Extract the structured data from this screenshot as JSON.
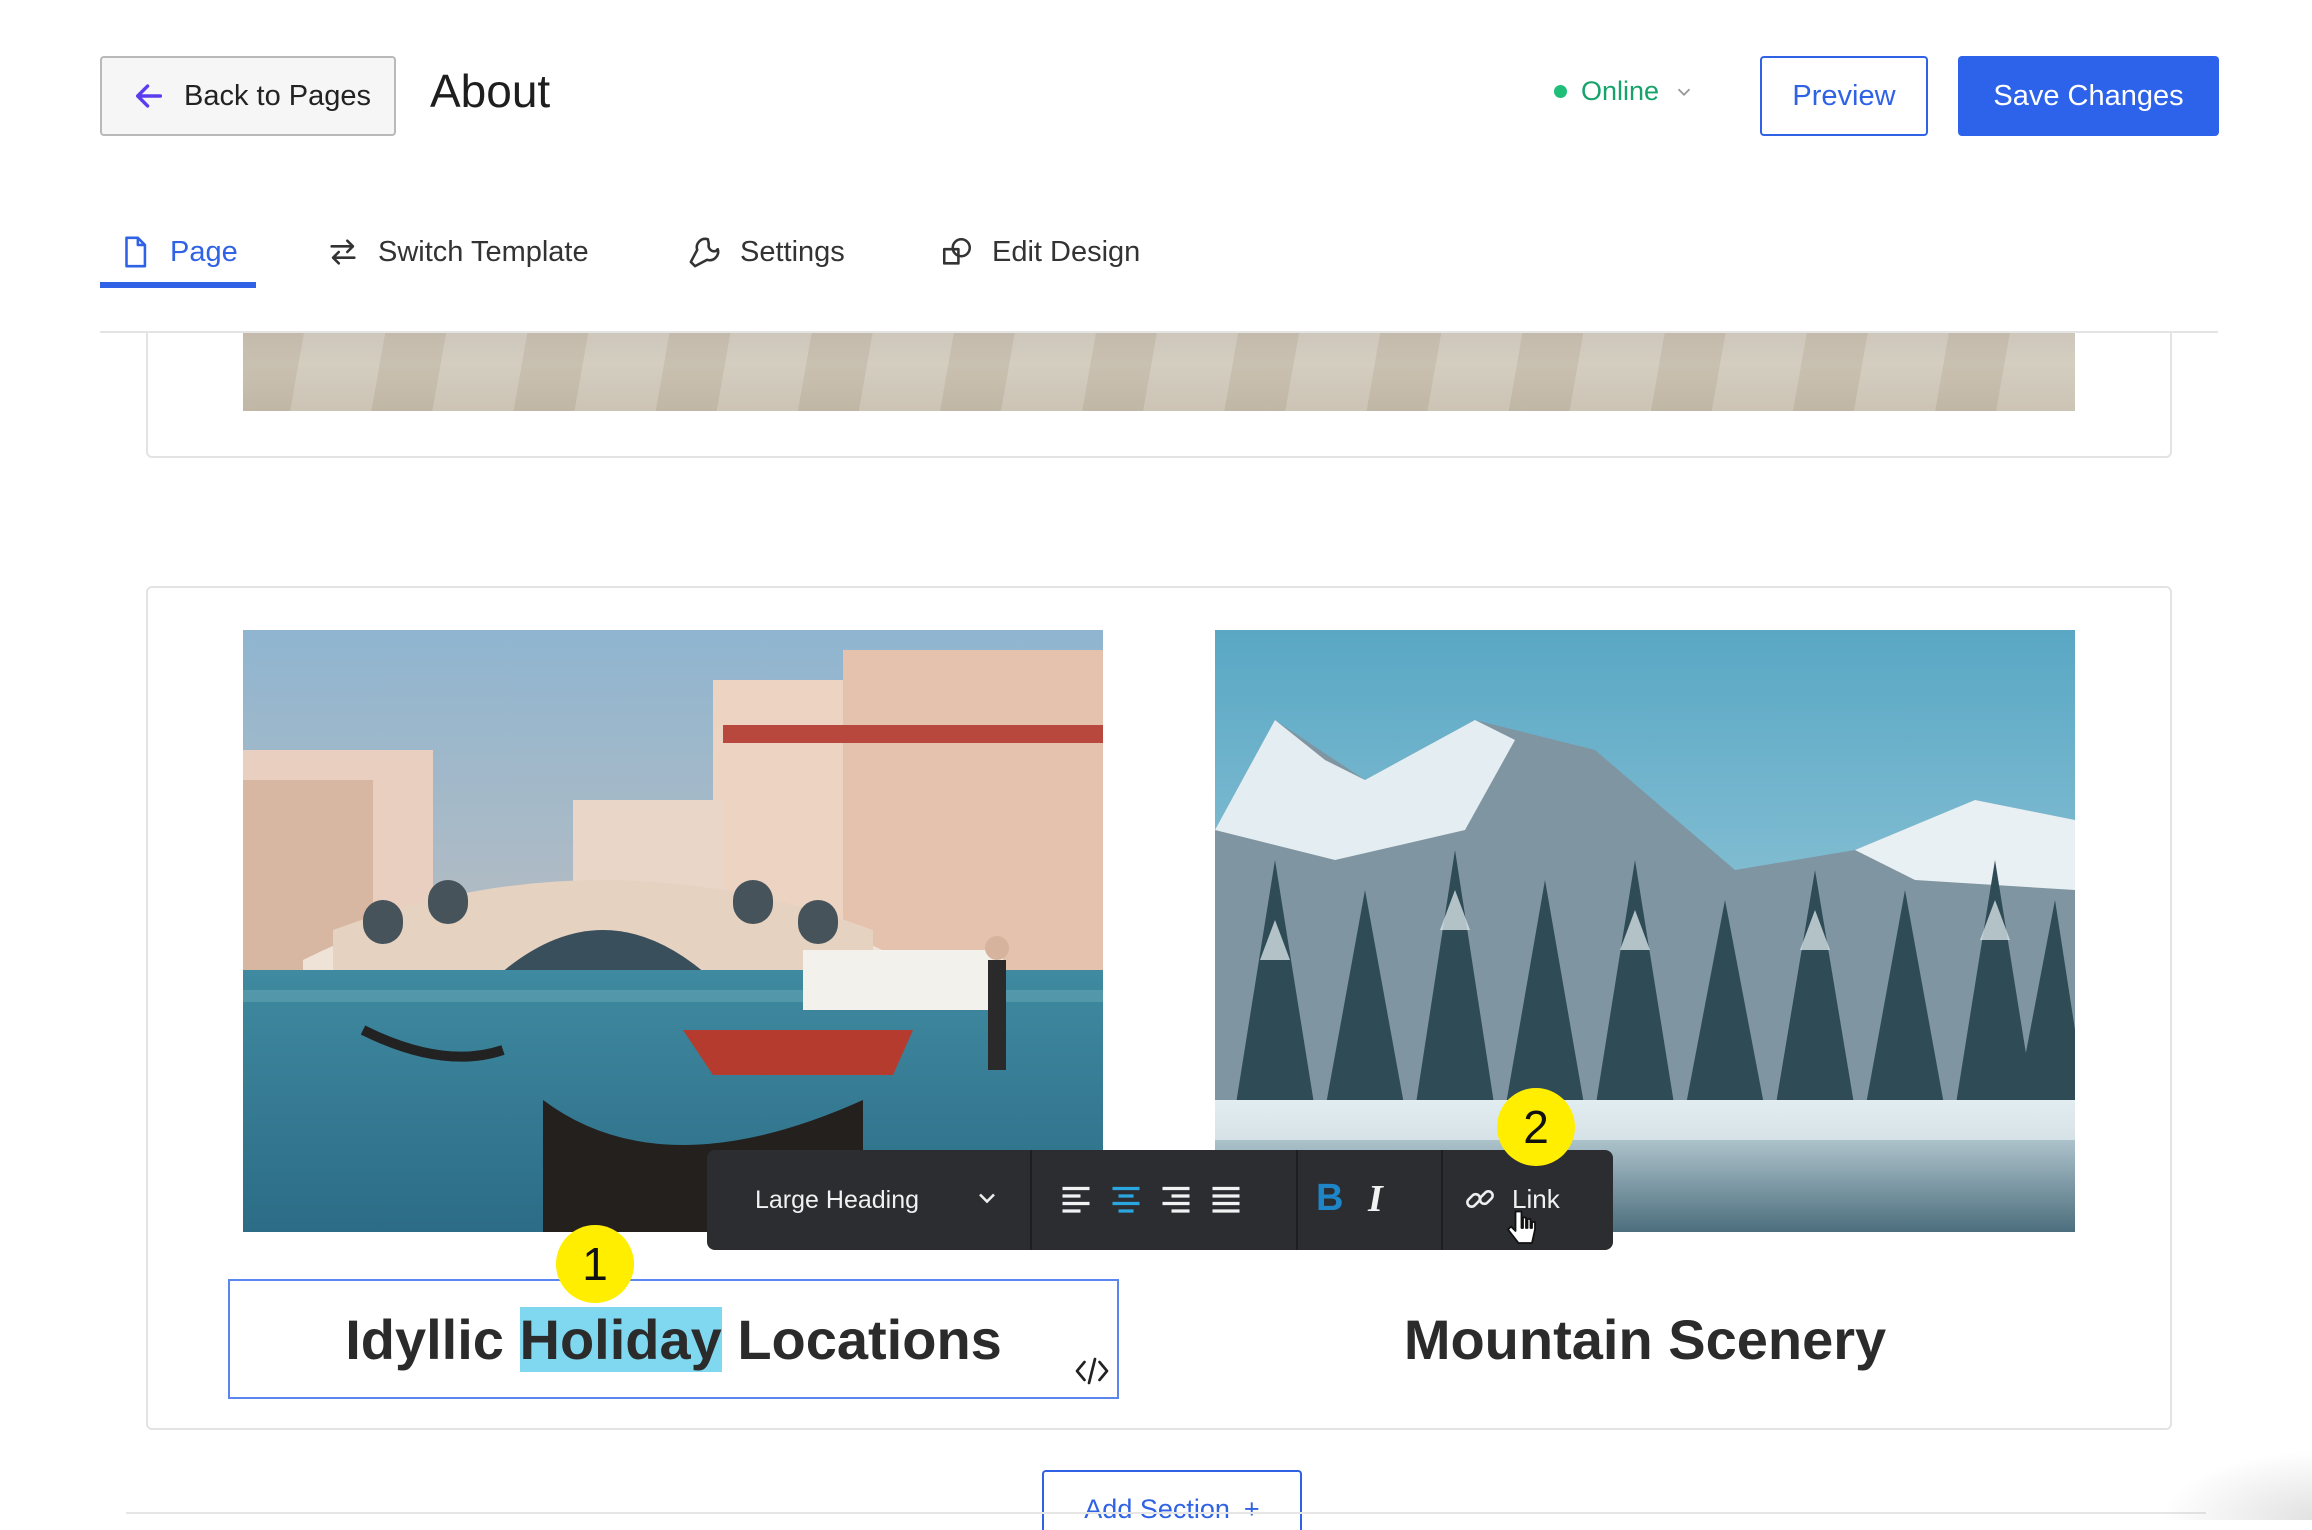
{
  "header": {
    "back_label": "Back to Pages",
    "page_title": "About",
    "status_label": "Online",
    "preview_label": "Preview",
    "save_label": "Save Changes"
  },
  "tabs": [
    {
      "label": "Page",
      "icon": "page-icon",
      "active": true
    },
    {
      "label": "Switch Template",
      "icon": "switch-icon",
      "active": false
    },
    {
      "label": "Settings",
      "icon": "wrench-icon",
      "active": false
    },
    {
      "label": "Edit Design",
      "icon": "design-icon",
      "active": false
    }
  ],
  "columns": [
    {
      "image": "venice-rialto-bridge-photo",
      "heading_before": "Idyllic ",
      "heading_highlight": "Holiday",
      "heading_after": " Locations"
    },
    {
      "image": "snowy-mountain-forest-photo",
      "heading": "Mountain Scenery"
    }
  ],
  "toolbar": {
    "style_label": "Large Heading",
    "bold_label": "B",
    "italic_label": "I",
    "link_label": "Link",
    "active_alignment": "center"
  },
  "markers": {
    "one": "1",
    "two": "2"
  },
  "add_section": {
    "label": "Add Section",
    "icon": "+"
  },
  "colors": {
    "accent": "#2f62e4",
    "online": "#16a36b",
    "highlight": "#7fd8f0",
    "toolbar_bg": "#2c2d31",
    "marker": "#ffee00"
  }
}
